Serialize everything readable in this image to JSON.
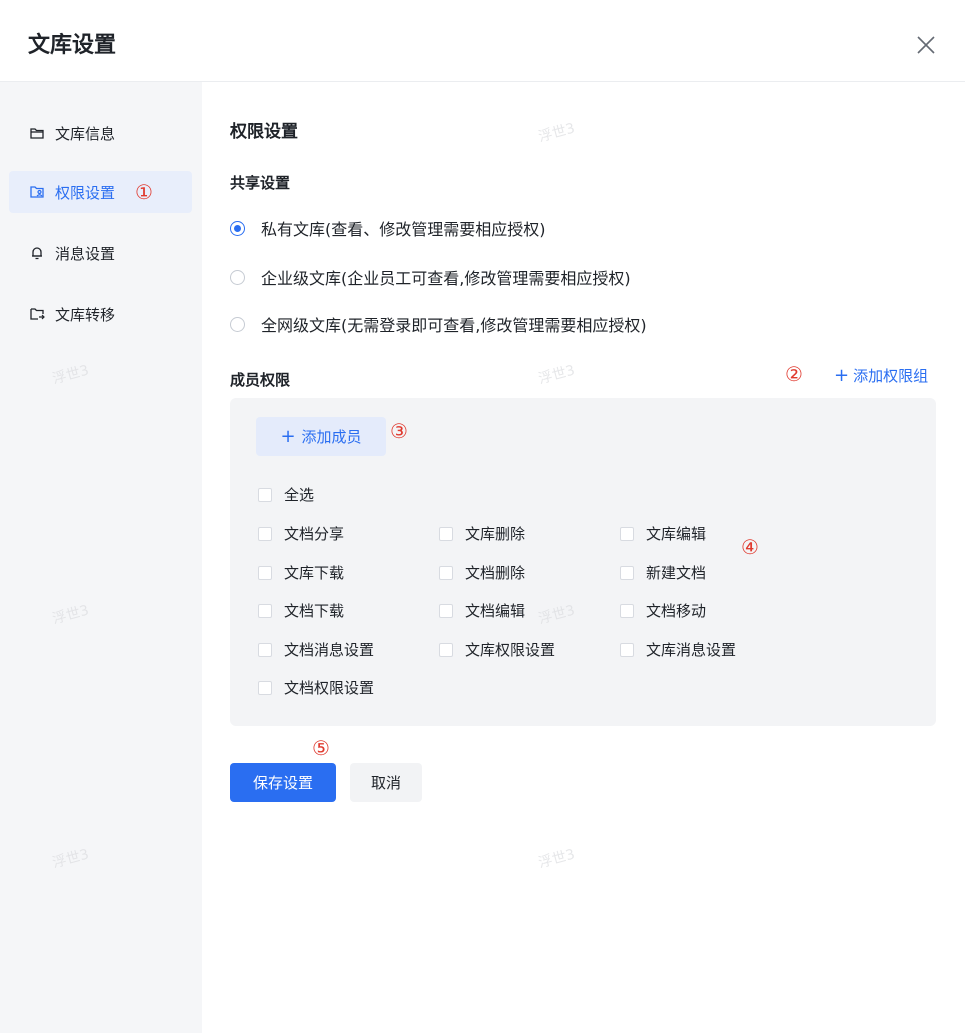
{
  "dialog": {
    "title": "文库设置",
    "close_icon": "close-icon"
  },
  "sidebar": {
    "items": [
      {
        "label": "文库信息",
        "icon": "folder-icon",
        "active": false
      },
      {
        "label": "权限设置",
        "icon": "permission-icon",
        "active": true,
        "marker": "①"
      },
      {
        "label": "消息设置",
        "icon": "bell-icon",
        "active": false
      },
      {
        "label": "文库转移",
        "icon": "folder-transfer-icon",
        "active": false
      }
    ]
  },
  "content": {
    "section_title": "权限设置",
    "share": {
      "title": "共享设置",
      "options": [
        {
          "label": "私有文库(查看、修改管理需要相应授权)",
          "checked": true
        },
        {
          "label": "企业级文库(企业员工可查看,修改管理需要相应授权)",
          "checked": false
        },
        {
          "label": "全网级文库(无需登录即可查看,修改管理需要相应授权)",
          "checked": false
        }
      ]
    },
    "members": {
      "title": "成员权限",
      "add_group_marker": "②",
      "add_group_plus": "+",
      "add_group_label": "添加权限组",
      "add_member_plus": "+",
      "add_member_label": "添加成员",
      "add_member_marker": "③",
      "select_all": "全选",
      "permissions": [
        "文档分享",
        "文库删除",
        "文库编辑",
        "文库下载",
        "文档删除",
        "新建文档",
        "文档下载",
        "文档编辑",
        "文档移动",
        "文档消息设置",
        "文库权限设置",
        "文库消息设置",
        "文档权限设置"
      ],
      "permissions_marker": "④"
    },
    "actions": {
      "save_marker": "⑤",
      "save_label": "保存设置",
      "cancel_label": "取消"
    }
  },
  "watermark_text": "浮世3",
  "colors": {
    "accent": "#2a6ef1",
    "marker": "#e03a2f",
    "sidebar_bg": "#f5f6f8",
    "active_bg": "#e8eefb"
  }
}
